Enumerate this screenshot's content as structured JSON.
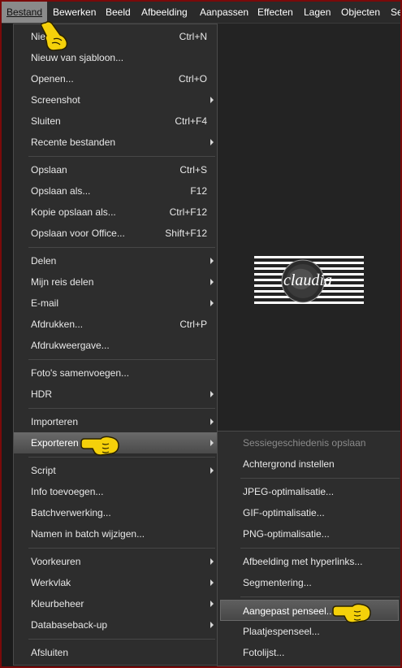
{
  "menubar": {
    "items": [
      {
        "label": "Bestand"
      },
      {
        "label": "Bewerken"
      },
      {
        "label": "Beeld"
      },
      {
        "label": "Afbeelding"
      },
      {
        "label": "Aanpassen"
      },
      {
        "label": "Effecten"
      },
      {
        "label": "Lagen"
      },
      {
        "label": "Objecten"
      },
      {
        "label": "Se"
      }
    ]
  },
  "file_menu": {
    "items": [
      {
        "label": "Nieuw",
        "shortcut": "Ctrl+N"
      },
      {
        "label": "Nieuw van sjabloon...",
        "shortcut": ""
      },
      {
        "label": "Openen...",
        "shortcut": "Ctrl+O"
      },
      {
        "label": "Screenshot",
        "shortcut": ""
      },
      {
        "label": "Sluiten",
        "shortcut": "Ctrl+F4"
      },
      {
        "label": "Recente bestanden",
        "shortcut": ""
      },
      {
        "label": "Opslaan",
        "shortcut": "Ctrl+S"
      },
      {
        "label": "Opslaan als...",
        "shortcut": "F12"
      },
      {
        "label": "Kopie opslaan als...",
        "shortcut": "Ctrl+F12"
      },
      {
        "label": "Opslaan voor Office...",
        "shortcut": "Shift+F12"
      },
      {
        "label": "Delen",
        "shortcut": ""
      },
      {
        "label": "Mijn reis delen",
        "shortcut": ""
      },
      {
        "label": "E-mail",
        "shortcut": ""
      },
      {
        "label": "Afdrukken...",
        "shortcut": "Ctrl+P"
      },
      {
        "label": "Afdrukweergave...",
        "shortcut": ""
      },
      {
        "label": "Foto's samenvoegen...",
        "shortcut": ""
      },
      {
        "label": "HDR",
        "shortcut": ""
      },
      {
        "label": "Importeren",
        "shortcut": ""
      },
      {
        "label": "Exporteren",
        "shortcut": ""
      },
      {
        "label": "Script",
        "shortcut": ""
      },
      {
        "label": "Info toevoegen...",
        "shortcut": ""
      },
      {
        "label": "Batchverwerking...",
        "shortcut": ""
      },
      {
        "label": "Namen in batch wijzigen...",
        "shortcut": ""
      },
      {
        "label": "Voorkeuren",
        "shortcut": ""
      },
      {
        "label": "Werkvlak",
        "shortcut": ""
      },
      {
        "label": "Kleurbeheer",
        "shortcut": ""
      },
      {
        "label": "Databaseback-up",
        "shortcut": ""
      },
      {
        "label": "Afsluiten",
        "shortcut": ""
      }
    ]
  },
  "export_submenu": {
    "items": [
      {
        "label": "Sessiegeschiedenis opslaan"
      },
      {
        "label": "Achtergrond instellen"
      },
      {
        "label": "JPEG-optimalisatie..."
      },
      {
        "label": "GIF-optimalisatie..."
      },
      {
        "label": "PNG-optimalisatie..."
      },
      {
        "label": "Afbeelding met hyperlinks..."
      },
      {
        "label": "Segmentering..."
      },
      {
        "label": "Aangepast penseel..."
      },
      {
        "label": "Plaatjespenseel..."
      },
      {
        "label": "Fotolijst..."
      }
    ]
  },
  "watermark": {
    "text": "claudia"
  },
  "colors": {
    "pointer": "#f5d10a",
    "highlight": "#5a5a5a",
    "frame": "#7a0a0a"
  }
}
